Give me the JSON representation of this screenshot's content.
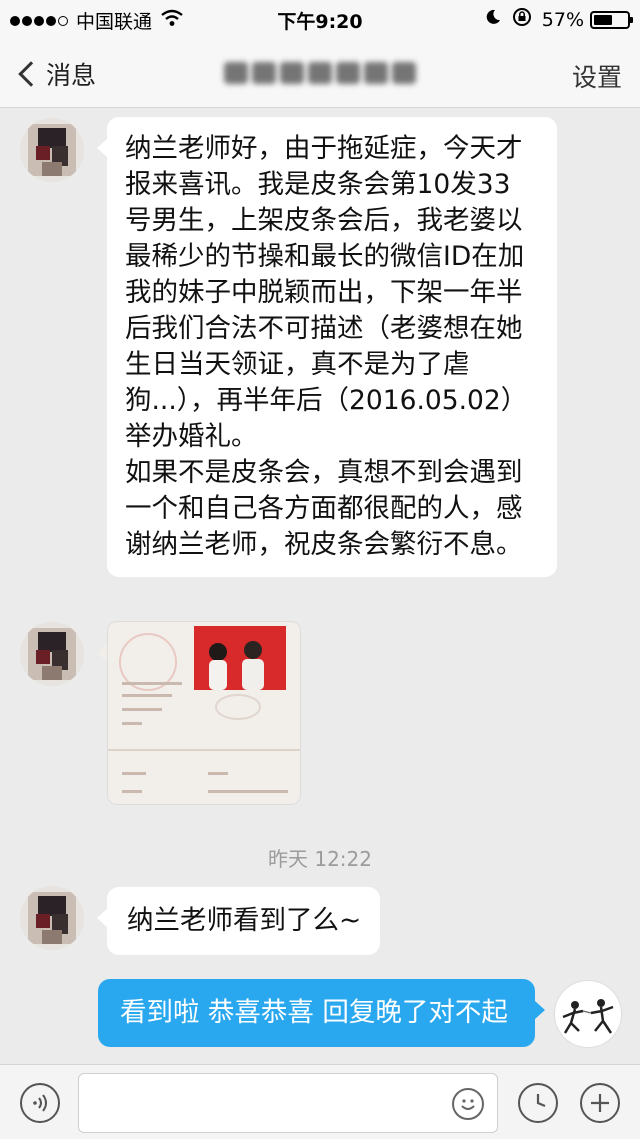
{
  "status_bar": {
    "carrier": "中国联通",
    "time": "下午9:20",
    "battery": "57%",
    "battery_level": 0.57
  },
  "nav": {
    "back_label": "消息",
    "settings_label": "设置"
  },
  "messages": {
    "msg1_lines": [
      "纳兰老师好，由于拖延症，今天才",
      "报来喜讯。我是皮条会第10发33",
      "号男生，上架皮条会后，我老婆以",
      "最稀少的节操和最长的微信ID在加",
      "我的妹子中脱颖而出，下架一年半",
      "后我们合法不可描述（老婆想在她",
      "生日当天领证，真不是为了虐",
      "狗...），再半年后（2016.05.02）",
      "举办婚礼。",
      "如果不是皮条会，真想不到会遇到",
      "一个和自己各方面都很配的人，感",
      "谢纳兰老师，祝皮条会繁衍不息。"
    ],
    "timestamp": "昨天 12:22",
    "msg2": "纳兰老师看到了么~",
    "msg3": "看到啦 恭喜恭喜 回复晚了对不起"
  },
  "colors": {
    "sent_bubble": "#2aa8ef",
    "received_bubble": "#ffffff",
    "background": "#ebebeb"
  }
}
